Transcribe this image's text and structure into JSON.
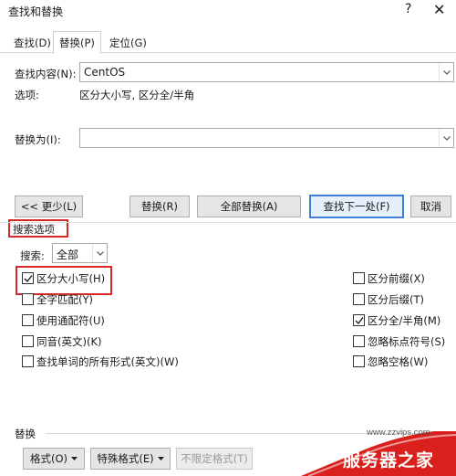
{
  "window": {
    "title": "查找和替换",
    "help_glyph": "?",
    "close_glyph": "✕"
  },
  "tabs": [
    {
      "label": "查找(D)",
      "active": false
    },
    {
      "label": "替换(P)",
      "active": true
    },
    {
      "label": "定位(G)",
      "active": false
    }
  ],
  "find": {
    "label": "查找内容(N):",
    "value": "CentOS",
    "options_label": "选项:",
    "options_value": "区分大小写, 区分全/半角"
  },
  "replace": {
    "label": "替换为(I):",
    "value": ""
  },
  "buttons": {
    "less": "<< 更少(L)",
    "replace": "替换(R)",
    "replace_all": "全部替换(A)",
    "find_next": "查找下一处(F)",
    "cancel": "取消"
  },
  "search_options": {
    "heading": "搜索选项",
    "search_label": "搜索:",
    "search_value": "全部"
  },
  "left_options": [
    {
      "label": "区分大小写(H)",
      "checked": true
    },
    {
      "label": "全字匹配(Y)",
      "checked": false
    },
    {
      "label": "使用通配符(U)",
      "checked": false
    },
    {
      "label": "同音(英文)(K)",
      "checked": false
    },
    {
      "label": "查找单词的所有形式(英文)(W)",
      "checked": false
    }
  ],
  "right_options": [
    {
      "label": "区分前缀(X)",
      "checked": false
    },
    {
      "label": "区分后缀(T)",
      "checked": false
    },
    {
      "label": "区分全/半角(M)",
      "checked": true
    },
    {
      "label": "忽略标点符号(S)",
      "checked": false
    },
    {
      "label": "忽略空格(W)",
      "checked": false
    }
  ],
  "replace_section": {
    "heading": "替换",
    "format_button": "格式(O)",
    "special_button": "特殊格式(E)",
    "no_format_button": "不限定格式(T)"
  },
  "watermark": {
    "url": "www.zzvips.com",
    "logo": "服务器之家"
  },
  "colors": {
    "highlight_red": "#d62a2a",
    "primary_border": "#3c7fd6",
    "watermark_red": "#d9201c"
  }
}
